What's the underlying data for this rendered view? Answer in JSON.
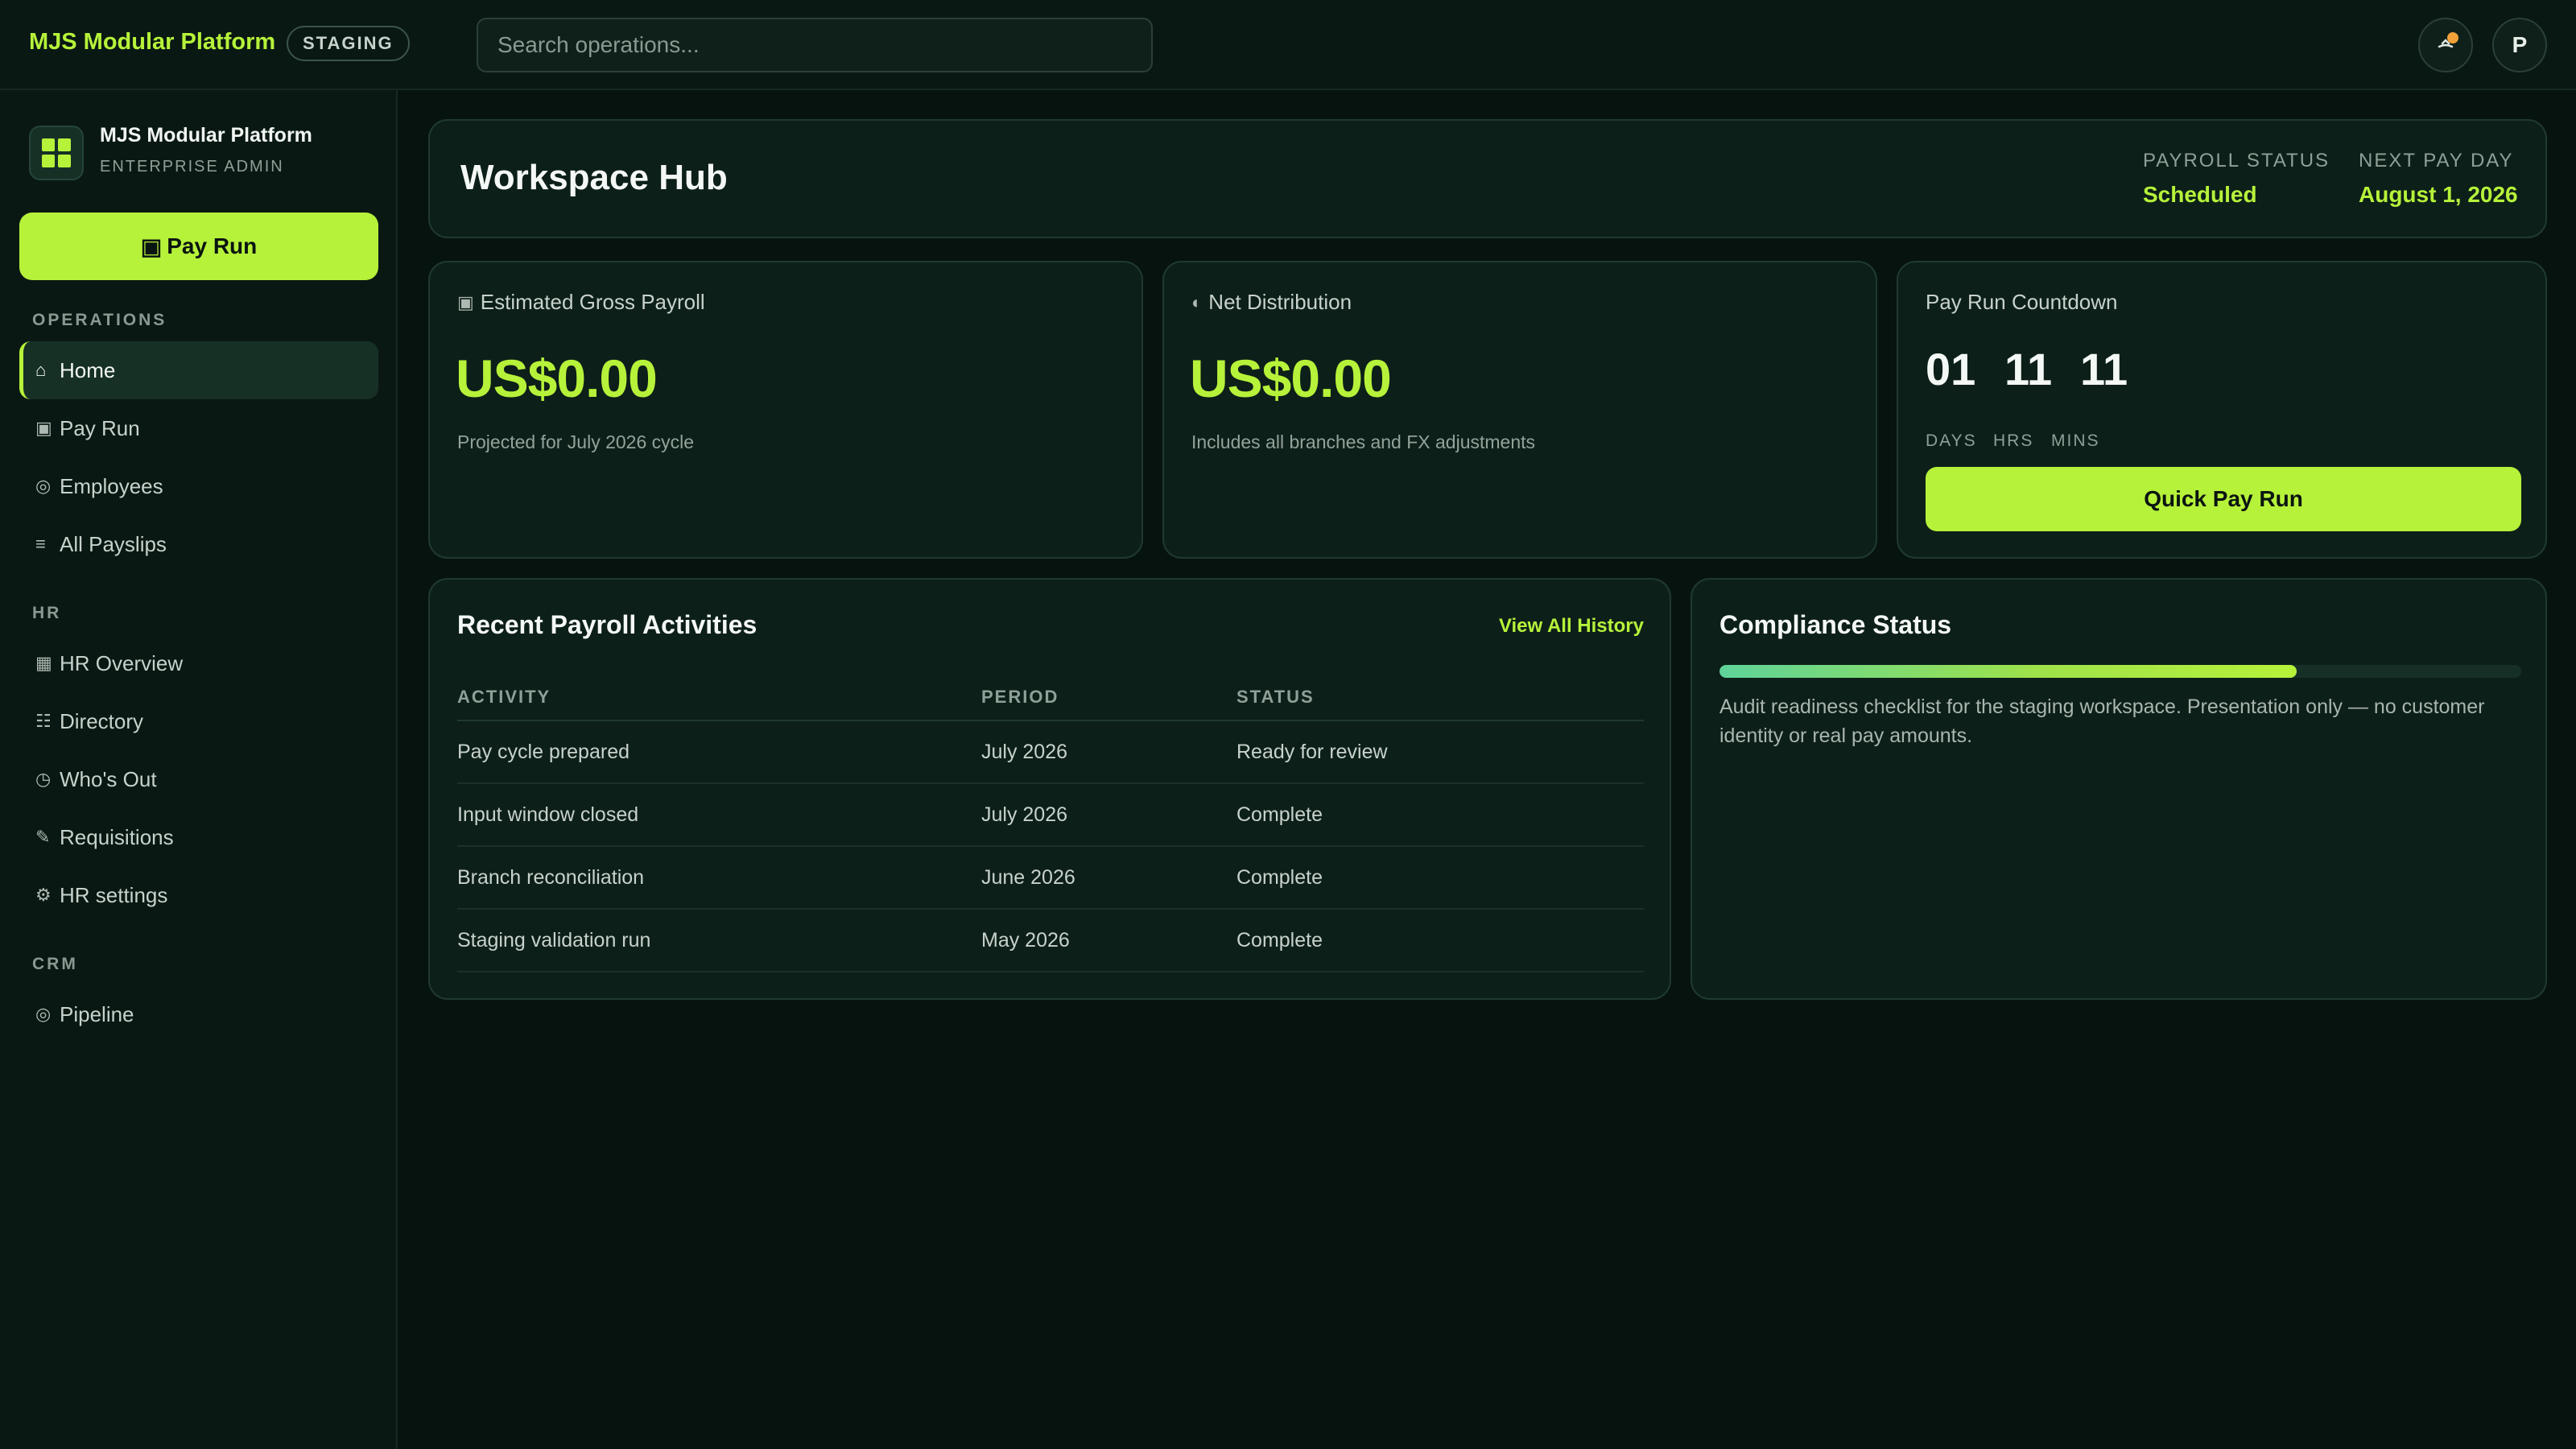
{
  "topbar": {
    "brand": "MJS Modular Platform",
    "env_badge": "STAGING",
    "search_placeholder": "Search operations...",
    "avatar_initial": "P",
    "accent_color": "#b6f23a",
    "notification_dot_color": "#f2a13a"
  },
  "sidebar": {
    "org_name": "MJS Modular Platform",
    "org_role": "ENTERPRISE ADMIN",
    "primary_button": {
      "icon": "▣",
      "label": "Pay Run"
    },
    "sections": [
      {
        "label": "OPERATIONS",
        "items": [
          {
            "icon": "⌂",
            "label": "Home",
            "active": true
          },
          {
            "icon": "▣",
            "label": "Pay Run"
          },
          {
            "icon": "◎",
            "label": "Employees"
          },
          {
            "icon": "≡",
            "label": "All Payslips"
          }
        ]
      },
      {
        "label": "HR",
        "items": [
          {
            "icon": "▦",
            "label": "HR Overview"
          },
          {
            "icon": "☷",
            "label": "Directory"
          },
          {
            "icon": "◷",
            "label": "Who's Out"
          },
          {
            "icon": "✎",
            "label": "Requisitions"
          },
          {
            "icon": "⚙",
            "label": "HR settings"
          }
        ]
      },
      {
        "label": "CRM",
        "items": [
          {
            "icon": "◎",
            "label": "Pipeline"
          }
        ]
      }
    ]
  },
  "hub": {
    "title": "Workspace Hub",
    "payroll_status_label": "PAYROLL STATUS",
    "payroll_status_value": "Scheduled",
    "next_pay_day_label": "NEXT PAY DAY",
    "next_pay_day_value": "August 1, 2026"
  },
  "stats": {
    "gross": {
      "icon": "▣",
      "title": "Estimated Gross Payroll",
      "value": "US$0.00",
      "subtitle": "Projected for July 2026 cycle"
    },
    "net": {
      "icon": "◐",
      "title": "Net Distribution",
      "value": "US$0.00",
      "subtitle": "Includes all branches and FX adjustments"
    }
  },
  "countdown": {
    "title": "Pay Run Countdown",
    "days": "01",
    "hours": "11",
    "minutes": "11",
    "days_label": "DAYS",
    "hours_label": "HRS",
    "minutes_label": "MINS",
    "button_label": "Quick Pay Run"
  },
  "activities": {
    "title": "Recent Payroll Activities",
    "view_all_label": "View All History",
    "columns": [
      "ACTIVITY",
      "PERIOD",
      "STATUS"
    ],
    "rows": [
      [
        "Pay cycle prepared",
        "July 2026",
        "Ready for review"
      ],
      [
        "Input window closed",
        "July 2026",
        "Complete"
      ],
      [
        "Branch reconciliation",
        "June 2026",
        "Complete"
      ],
      [
        "Staging validation run",
        "May 2026",
        "Complete"
      ]
    ]
  },
  "compliance": {
    "title": "Compliance Status",
    "progress_fraction": 0.72,
    "description": "Audit readiness checklist for the staging workspace. Presentation only — no customer identity or real pay amounts."
  }
}
